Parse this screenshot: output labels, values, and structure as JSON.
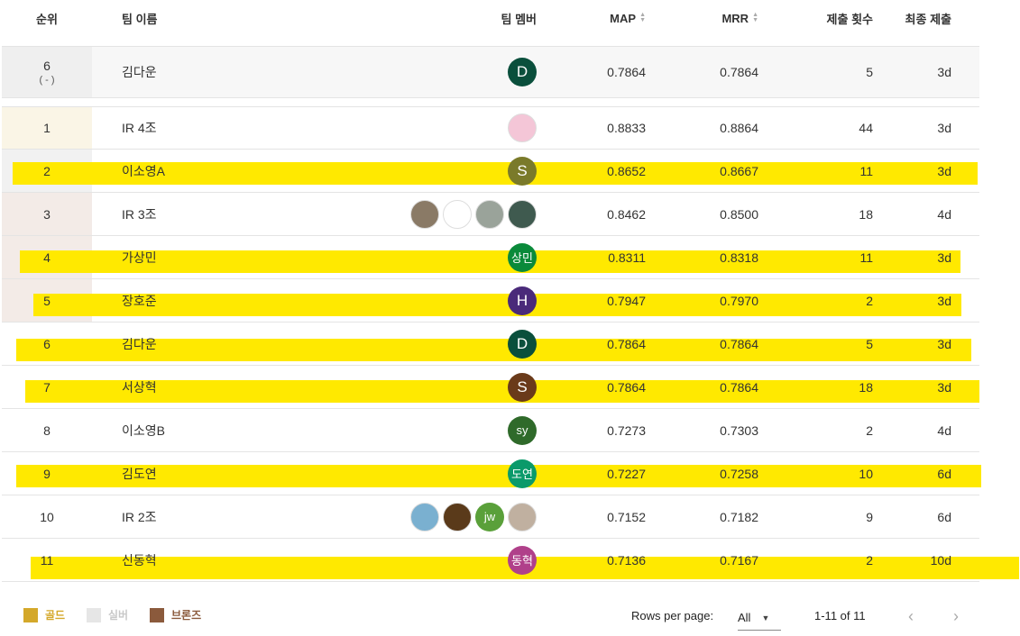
{
  "header": {
    "rank": "순위",
    "team_name": "팀 이름",
    "team_members": "팀 멤버",
    "map": "MAP",
    "mrr": "MRR",
    "submissions": "제출 횟수",
    "last_submission": "최종 제출"
  },
  "my_team": {
    "rank": "6",
    "rank_change": "( - )",
    "name": "김다운",
    "members": [
      {
        "label": "D",
        "color": "#0a4f3c"
      }
    ],
    "map": "0.7864",
    "mrr": "0.7864",
    "submissions": "5",
    "last": "3d"
  },
  "rows": [
    {
      "rank": "1",
      "name": "IR 4조",
      "tier": "gold",
      "members": [
        {
          "label": "",
          "color": "#f4c6d7",
          "photo": true
        }
      ],
      "map": "0.8833",
      "mrr": "0.8864",
      "submissions": "44",
      "last": "3d",
      "highlighted": false
    },
    {
      "rank": "2",
      "name": "이소영A",
      "tier": "silver",
      "members": [
        {
          "label": "S",
          "color": "#7a7a2a"
        }
      ],
      "map": "0.8652",
      "mrr": "0.8667",
      "submissions": "11",
      "last": "3d",
      "highlighted": true
    },
    {
      "rank": "3",
      "name": "IR 3조",
      "tier": "bronze",
      "members": [
        {
          "label": "",
          "color": "#8a7a66",
          "photo": true
        },
        {
          "label": "",
          "color": "#ffffff",
          "photo": true
        },
        {
          "label": "",
          "color": "#9aa39a",
          "photo": true
        },
        {
          "label": "",
          "color": "#3f5a4f",
          "photo": true
        }
      ],
      "map": "0.8462",
      "mrr": "0.8500",
      "submissions": "18",
      "last": "4d",
      "highlighted": false
    },
    {
      "rank": "4",
      "name": "가상민",
      "tier": "bronze",
      "members": [
        {
          "label": "상민",
          "color": "#0a8a3a"
        }
      ],
      "map": "0.8311",
      "mrr": "0.8318",
      "submissions": "11",
      "last": "3d",
      "highlighted": true
    },
    {
      "rank": "5",
      "name": "장호준",
      "tier": "bronze",
      "members": [
        {
          "label": "H",
          "color": "#4a2a7a"
        }
      ],
      "map": "0.7947",
      "mrr": "0.7970",
      "submissions": "2",
      "last": "3d",
      "highlighted": true
    },
    {
      "rank": "6",
      "name": "김다운",
      "tier": "",
      "members": [
        {
          "label": "D",
          "color": "#0a4f3c"
        }
      ],
      "map": "0.7864",
      "mrr": "0.7864",
      "submissions": "5",
      "last": "3d",
      "highlighted": true
    },
    {
      "rank": "7",
      "name": "서상혁",
      "tier": "",
      "members": [
        {
          "label": "S",
          "color": "#6a3a1a"
        }
      ],
      "map": "0.7864",
      "mrr": "0.7864",
      "submissions": "18",
      "last": "3d",
      "highlighted": true
    },
    {
      "rank": "8",
      "name": "이소영B",
      "tier": "",
      "members": [
        {
          "label": "sy",
          "color": "#2f6a2a"
        }
      ],
      "map": "0.7273",
      "mrr": "0.7303",
      "submissions": "2",
      "last": "4d",
      "highlighted": false
    },
    {
      "rank": "9",
      "name": "김도연",
      "tier": "",
      "members": [
        {
          "label": "도연",
          "color": "#0a9a6a"
        }
      ],
      "map": "0.7227",
      "mrr": "0.7258",
      "submissions": "10",
      "last": "6d",
      "highlighted": true
    },
    {
      "rank": "10",
      "name": "IR 2조",
      "tier": "",
      "members": [
        {
          "label": "",
          "color": "#7ab0d0",
          "photo": true
        },
        {
          "label": "",
          "color": "#5a3a1a",
          "photo": true
        },
        {
          "label": "jw",
          "color": "#5aa03a"
        },
        {
          "label": "",
          "color": "#c0b0a0",
          "photo": true
        }
      ],
      "map": "0.7152",
      "mrr": "0.7182",
      "submissions": "9",
      "last": "6d",
      "highlighted": false
    },
    {
      "rank": "11",
      "name": "신동혁",
      "tier": "",
      "members": [
        {
          "label": "동혁",
          "color": "#b0408a"
        }
      ],
      "map": "0.7136",
      "mrr": "0.7167",
      "submissions": "2",
      "last": "10d",
      "highlighted": true
    }
  ],
  "legend": [
    {
      "label": "골드",
      "color": "#d4a82a"
    },
    {
      "label": "실버",
      "color": "#e6e6e6"
    },
    {
      "label": "브론즈",
      "color": "#8b5a3c"
    }
  ],
  "pagination": {
    "rows_per_page_label": "Rows per page:",
    "rows_per_page_value": "All",
    "range": "1-11 of 11"
  },
  "colors": {
    "gold": "#d4a82a",
    "silver": "#e6e6e6",
    "bronze": "#8b5a3c",
    "highlight": "#ffe900"
  },
  "icons": {
    "sort": "sort-icon",
    "dropdown": "caret-down-icon",
    "prev": "chevron-left-icon",
    "next": "chevron-right-icon"
  }
}
